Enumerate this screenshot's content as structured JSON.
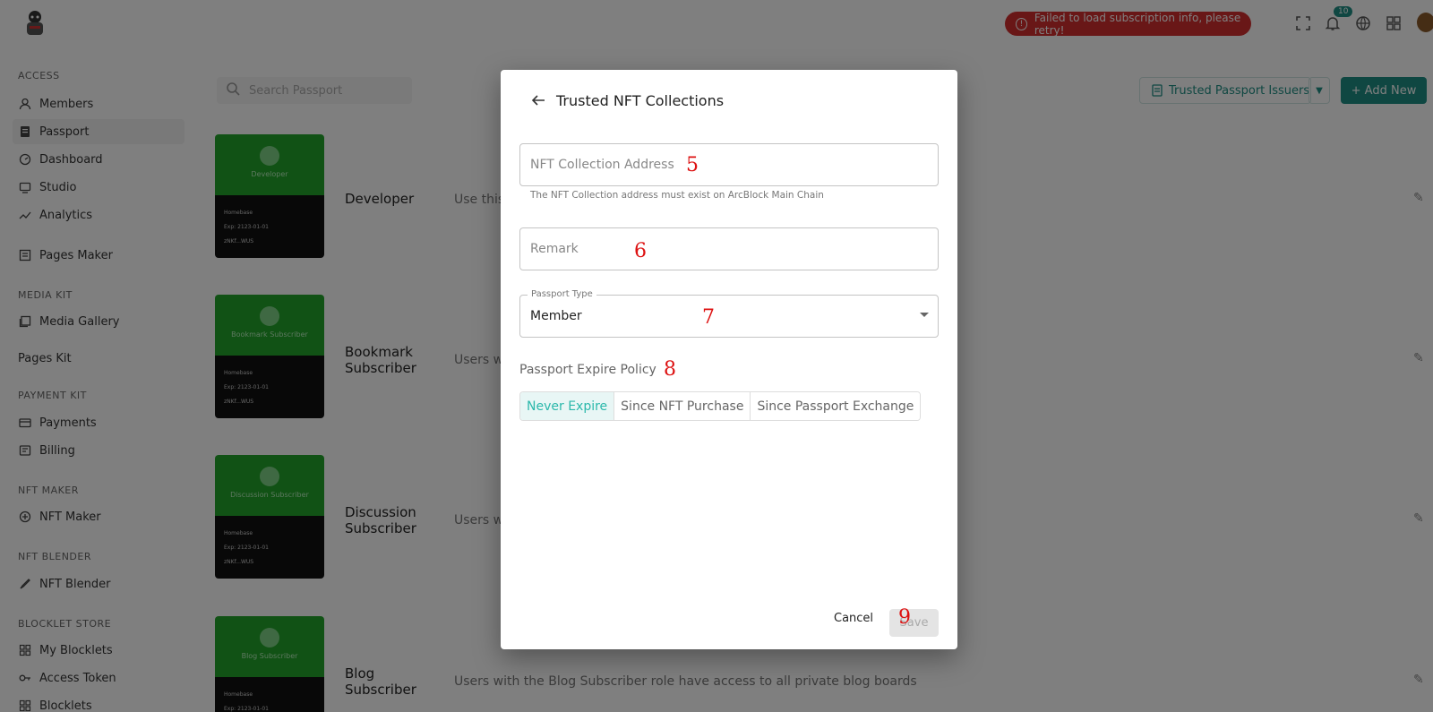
{
  "sidebar": {
    "sections": [
      {
        "title": "ACCESS"
      },
      {
        "title": "MEDIA KIT"
      },
      {
        "title": "PAYMENT KIT"
      },
      {
        "title": "NFT MAKER"
      },
      {
        "title": "NFT BLENDER"
      },
      {
        "title": "BLOCKLET STORE"
      }
    ],
    "items": [
      {
        "label": "Members",
        "icon": "person-icon"
      },
      {
        "label": "Passport",
        "icon": "passport-icon"
      },
      {
        "label": "Dashboard",
        "icon": "dashboard-icon"
      },
      {
        "label": "Studio",
        "icon": "studio-icon"
      },
      {
        "label": "Analytics",
        "icon": "analytics-icon"
      },
      {
        "label": "Pages Maker",
        "icon": "pages-icon"
      },
      {
        "label": "Media Gallery",
        "icon": "gallery-icon"
      },
      {
        "label": "Payments",
        "icon": "card-icon"
      },
      {
        "label": "Billing",
        "icon": "billing-icon"
      },
      {
        "label": "NFT Maker",
        "icon": "plus-circle-icon"
      },
      {
        "label": "NFT Blender",
        "icon": "brush-icon"
      },
      {
        "label": "My Blocklets",
        "icon": "grid-icon"
      },
      {
        "label": "Access Token",
        "icon": "key-icon"
      },
      {
        "label": "Blocklets",
        "icon": "grid-icon"
      }
    ],
    "pages_kit": "Pages Kit"
  },
  "topbar": {
    "error": "Failed to load subscription info, please retry!",
    "notification_count": "10"
  },
  "main": {
    "search_placeholder": "Search Passport",
    "issuers_button": "Trusted Passport Issuers",
    "add_button": "+ Add New",
    "passports": [
      {
        "card_name": "Developer",
        "title": "Developer",
        "desc": "Use this",
        "card_label": "Homebase",
        "exp": "Exp: 2123-01-01",
        "id": "zNKf...WUS"
      },
      {
        "card_name": "Bookmark Subscriber",
        "title": "Bookmark Subscriber",
        "desc": "Users w",
        "card_label": "Homebase",
        "exp": "Exp: 2123-01-01",
        "id": "zNKf...WUS"
      },
      {
        "card_name": "Discussion Subscriber",
        "title": "Discussion Subscriber",
        "desc": "Users w",
        "card_label": "Homebase",
        "exp": "Exp: 2123-01-01",
        "id": "zNKf...WUS"
      },
      {
        "card_name": "Blog Subscriber",
        "title": "Blog Subscriber",
        "desc": "Users with the Blog Subscriber role have access to all private blog boards",
        "card_label": "Homebase",
        "exp": "Exp: 2123-01-01",
        "id": ""
      }
    ]
  },
  "dialog": {
    "title": "Trusted NFT Collections",
    "address_placeholder": "NFT Collection Address",
    "address_helper": "The NFT Collection address must exist on ArcBlock Main Chain",
    "remark_placeholder": "Remark",
    "passport_type_label": "Passport Type",
    "passport_type_value": "Member",
    "expire_label": "Passport Expire Policy",
    "expire_options": [
      "Never Expire",
      "Since NFT Purchase",
      "Since Passport Exchange"
    ],
    "cancel_label": "Cancel",
    "save_label": "Save"
  },
  "annotations": [
    "5",
    "6",
    "7",
    "8",
    "9"
  ],
  "colors": {
    "accent": "#1f8f84",
    "selected_text": "#2bb8ab",
    "error": "#d32f2f",
    "annotation": "#dd1111"
  }
}
